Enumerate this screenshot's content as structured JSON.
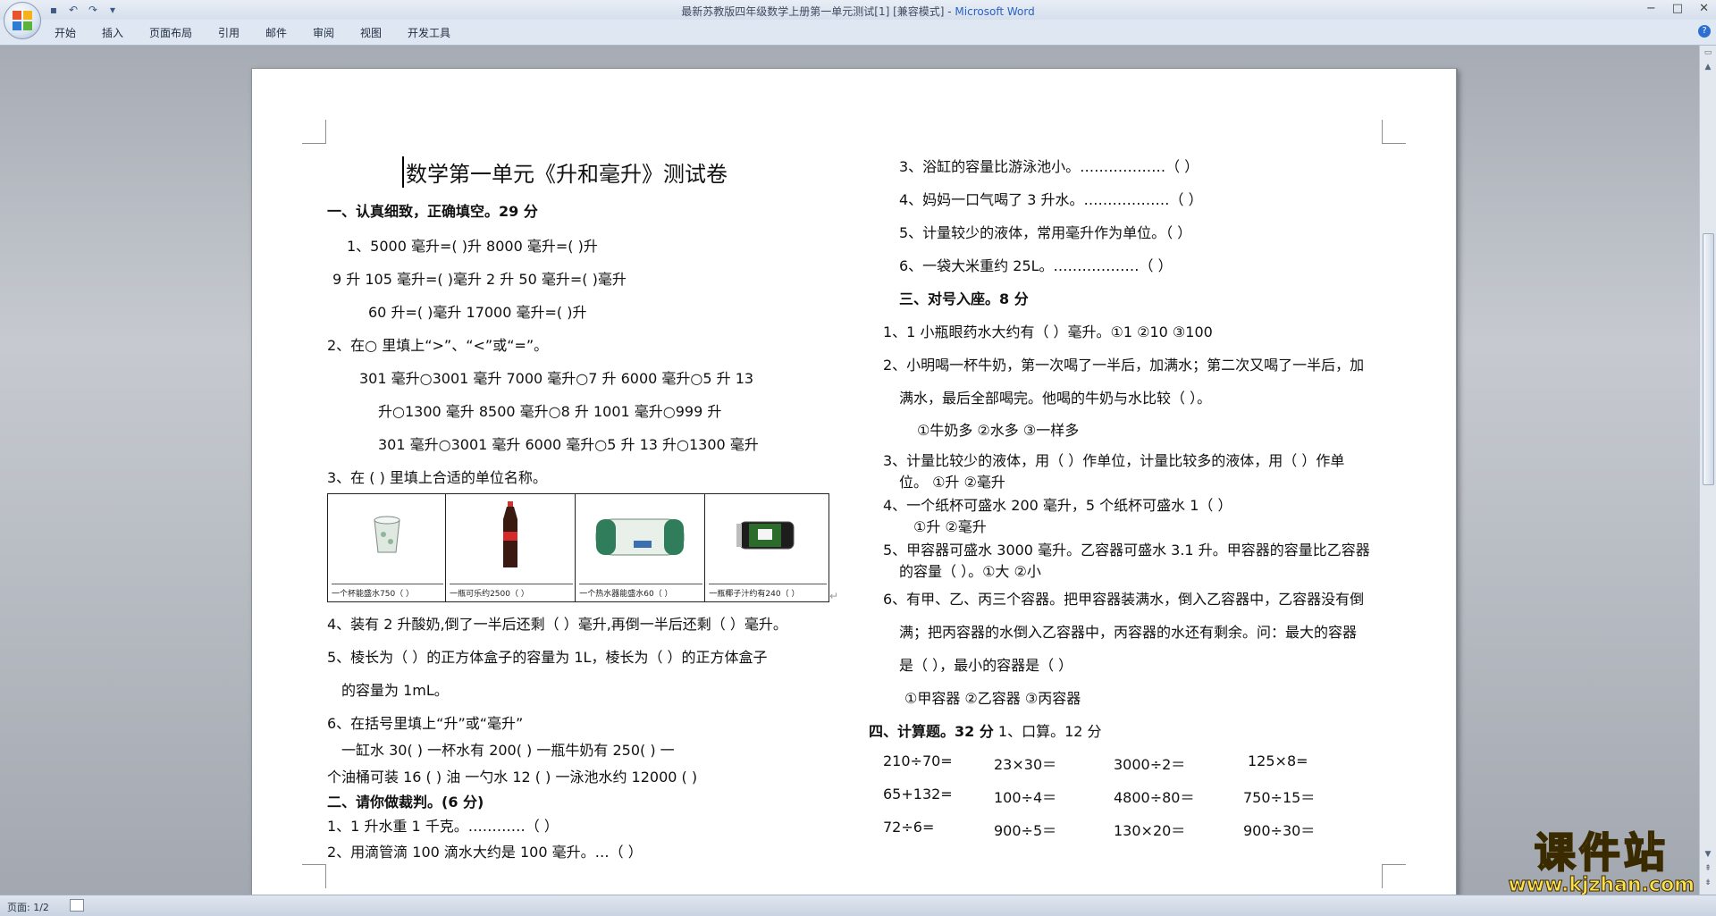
{
  "window": {
    "title": "最新苏教版四年级数学上册第一单元测试[1] [兼容模式] - ",
    "app_name": "Microsoft Word",
    "controls": [
      "−",
      "□",
      "✕"
    ]
  },
  "ribbon": {
    "tabs": [
      "开始",
      "插入",
      "页面布局",
      "引用",
      "邮件",
      "审阅",
      "视图",
      "开发工具"
    ]
  },
  "statusbar": {
    "page": "页面: 1/2"
  },
  "doc": {
    "title": "数学第一单元《升和毫升》测试卷",
    "s1": {
      "heading": "一、认真细致，正确填空。29 分",
      "q1_a": "1、5000 毫升=(    )升   8000 毫升=(    )升",
      "q1_b": "9 升 105 毫升=(     )毫升   2 升 50 毫升=(   )毫升",
      "q1_c": "60 升=(     )毫升      17000 毫升=(    )升",
      "q2": "2、在○ 里填上“>”、“<”或“=”。",
      "q2_a": "301 毫升○3001 毫升      7000 毫升○7 升        6000 毫升○5 升     13",
      "q2_b": "升○1300 毫升       8500 毫升○8 升       1001 毫升○999 升",
      "q2_c": "301 毫升○3001 毫升    6000 毫升○5 升        13 升○1300 毫升",
      "q3": "3、在 ( ) 里填上合适的单位名称。",
      "pics": [
        "一个杯能盛水750（   ）",
        "一瓶可乐约2500（    ）",
        "一个热水器能盛水60（    ）",
        "一瓶椰子汁约有240（   ）"
      ],
      "q4": "4、装有 2 升酸奶,倒了一半后还剩（     ）毫升,再倒一半后还剩（     ）毫升。",
      "q5_a": "5、棱长为（      ）的正方体盒子的容量为 1L，棱长为（       ）的正方体盒子",
      "q5_b": "的容量为 1mL。",
      "q6": "6、在括号里填上“升”或“毫升”",
      "q6_a": "一缸水 30(          )       一杯水有 200(      )      一瓶牛奶有 250(         )       一",
      "q6_b": "个油桶可装 16 (       ) 油     一勺水 12 (        )      一泳池水约 12000 (       )"
    },
    "s2": {
      "heading": "二、请你做裁判。(6 分)",
      "j1": "1、1 升水重 1 千克。…………（     ）",
      "j2": "2、用滴管滴 100 滴水大约是 100 毫升。…（     ）",
      "j3": "3、浴缸的容量比游泳池小。………………（     ）",
      "j4": "4、妈妈一口气喝了 3 升水。………………（     ）",
      "j5": "5、计量较少的液体，常用毫升作为单位。（     ）",
      "j6": "6、一袋大米重约 25L。………………（     ）"
    },
    "s3": {
      "heading": "三、对号入座。8 分",
      "c1": "1、1 小瓶眼药水大约有（ ）毫升。①1       ②10       ③100",
      "c2_a": "2、小明喝一杯牛奶，第一次喝了一半后，加满水；第二次又喝了一半后，加",
      "c2_b": "满水，最后全部喝完。他喝的牛奶与水比较（ ）。",
      "c2_opts": "①牛奶多      ②水多       ③一样多",
      "c3_a": "3、计量比较少的液体，用（    ）作单位，计量比较多的液体，用（    ）作单",
      "c3_b": "位。 ①升                     ②毫升",
      "c4_a": "4、一个纸杯可盛水 200 毫升，5 个纸杯可盛水 1（        ）",
      "c4_b": "①升                     ②毫升",
      "c5_a": "5、甲容器可盛水 3000 毫升。乙容器可盛水 3.1 升。甲容器的容量比乙容器",
      "c5_b": "的容量（          ）。①大              ②小",
      "c6_a": "6、有甲、乙、丙三个容器。把甲容器装满水，倒入乙容器中，乙容器没有倒",
      "c6_b": "满；把丙容器的水倒入乙容器中，丙容器的水还有剩余。问：最大的容器",
      "c6_c": "是（      ），最小的容器是（          ）",
      "c6_opts": "①甲容器          ②乙容器          ③丙容器"
    },
    "s4": {
      "heading": "四、计算题。32 分",
      "sub": " 1、口算。12 分",
      "calc": [
        [
          "210÷70=",
          "23×30＝",
          "3000÷2＝",
          "125×8="
        ],
        [
          "65+132=",
          "100÷4＝",
          "4800÷80＝",
          "750÷15＝"
        ],
        [
          "72÷6=",
          "900÷5＝",
          "130×20＝",
          "900÷30＝"
        ]
      ]
    },
    "para_mark": "↵"
  },
  "watermark": {
    "text": "课件站",
    "url": "www.kjzhan.com"
  }
}
